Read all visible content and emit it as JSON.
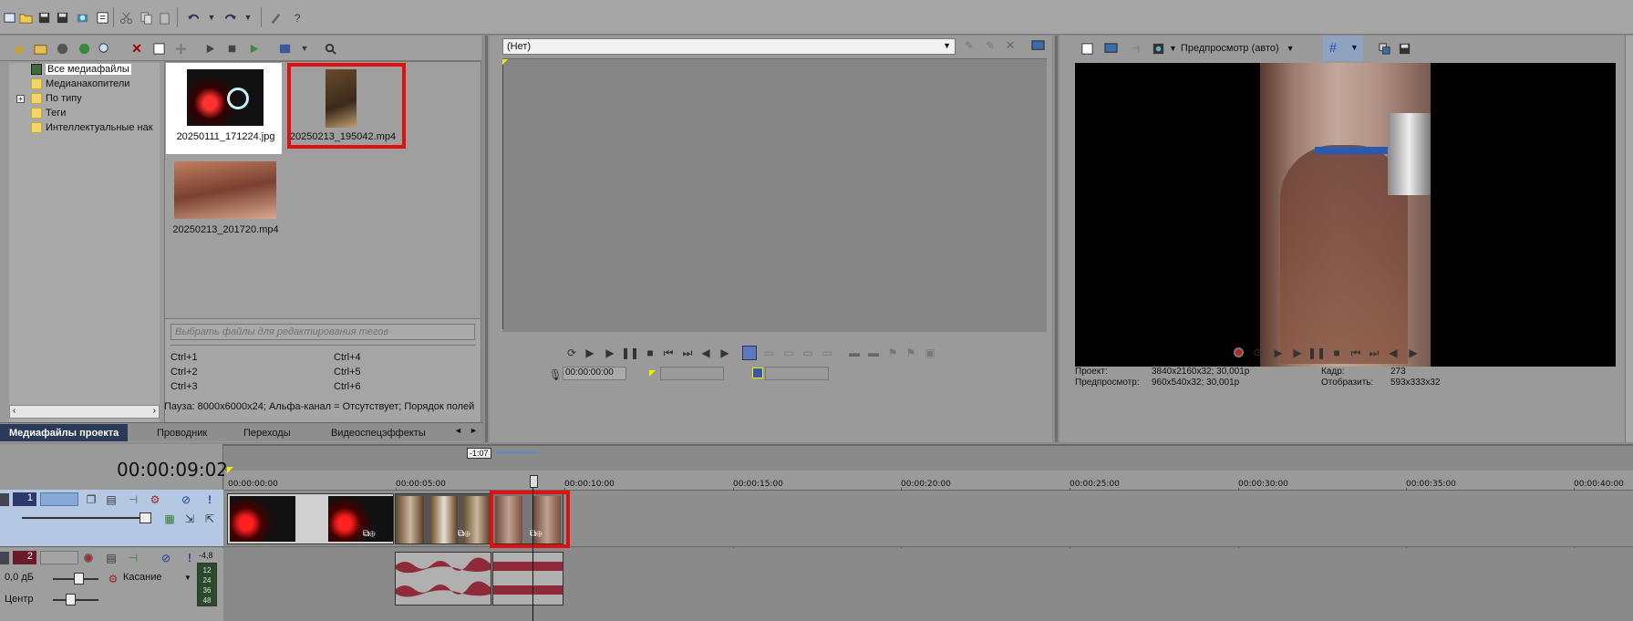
{
  "colors": {
    "background": "#8c8c8c",
    "panel": "#9a9a9a",
    "selection_red": "#e01010",
    "audio_clip": "#8e2a3a",
    "track_blue": "#b4c8e4"
  },
  "explorer": {
    "tree": [
      {
        "label": "Все медиафайлы",
        "icon": "media-folder-icon",
        "selected": true
      },
      {
        "label": "Медианакопители",
        "icon": "folder-icon"
      },
      {
        "label": "По типу",
        "icon": "folder-icon",
        "expandable": true
      },
      {
        "label": "Теги",
        "icon": "folder-icon"
      },
      {
        "label": "Интеллектуальные нак",
        "icon": "folder-icon"
      }
    ],
    "files": [
      {
        "name": "20250111_171224.jpg"
      },
      {
        "name": "20250213_195042.mp4"
      },
      {
        "name": "20250213_201720.mp4"
      }
    ],
    "tag_placeholder": "Выбрать файлы для редактирования тегов",
    "shortcuts": [
      "Ctrl+1",
      "Ctrl+4",
      "Ctrl+2",
      "Ctrl+5",
      "Ctrl+3",
      "Ctrl+6"
    ],
    "status": "Пауза: 8000x6000x24; Альфа-канал = Отсутствует; Порядок полей",
    "tabs": [
      "Медиафайлы проекта",
      "Проводник",
      "Переходы",
      "Видеоспецэффекты"
    ]
  },
  "trimmer": {
    "dropdown_value": "(Нет)",
    "timecode": "00:00:00:00"
  },
  "preview": {
    "quality_label": "Предпросмотр (авто)",
    "info": {
      "project_label": "Проект:",
      "project_value": "3840x2160x32; 30,001p",
      "preview_label": "Предпросмотр:",
      "preview_value": "960x540x32; 30,001p",
      "frame_label": "Кадр:",
      "frame_value": "273",
      "display_label": "Отобразить:",
      "display_value": "593x333x32"
    }
  },
  "timeline": {
    "current_time": "00:00:09:02",
    "marker_label": "-1:07",
    "ruler": [
      "00:00:00:00",
      "00:00:05:00",
      "00:00:10:00",
      "00:00:15:00",
      "00:00:20:00",
      "00:00:25:00",
      "00:00:30:00",
      "00:00:35:00",
      "00:00:40:00"
    ],
    "video_track_number": "1",
    "audio_track_number": "2",
    "audio_volume": "0,0 дБ",
    "audio_mode": "Касание",
    "audio_pan": "Центр",
    "meter_top": "-4,8",
    "meter_scale": [
      "12",
      "24",
      "36",
      "48"
    ]
  }
}
